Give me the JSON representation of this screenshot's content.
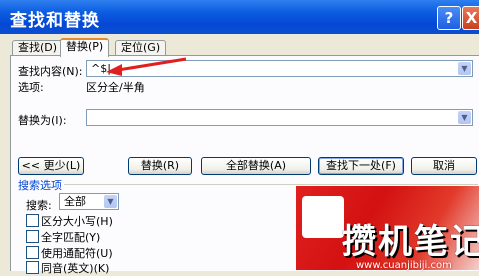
{
  "window": {
    "title": "查找和替换",
    "help_glyph": "?",
    "close_glyph": "X"
  },
  "tabs": [
    {
      "label": "查找(D)"
    },
    {
      "label": "替换(P)"
    },
    {
      "label": "定位(G)"
    }
  ],
  "find": {
    "label": "查找内容(N):",
    "value": "^$|"
  },
  "options": {
    "label": "选项:",
    "value": "区分全/半角"
  },
  "replace": {
    "label": "替换为(I):",
    "value": ""
  },
  "buttons": {
    "less": "<< 更少(L)",
    "replace": "替换(R)",
    "replace_all": "全部替换(A)",
    "find_next": "查找下一处(F)",
    "cancel": "取消"
  },
  "search_options": {
    "section_label": "搜索选项",
    "search_label": "搜索:",
    "search_value": "全部",
    "checkboxes": [
      {
        "label": "区分大小写(H)"
      },
      {
        "label": "全字匹配(Y)"
      },
      {
        "label": "使用通配符(U)"
      },
      {
        "label": "同音(英文)(K)"
      }
    ]
  },
  "watermark": {
    "title": "攒机笔记",
    "url": "www.cuanjibiji.com"
  },
  "colors": {
    "titlebar": "#0a4fd0",
    "annotation_arrow": "#e02020",
    "section_label": "#0046d5"
  }
}
